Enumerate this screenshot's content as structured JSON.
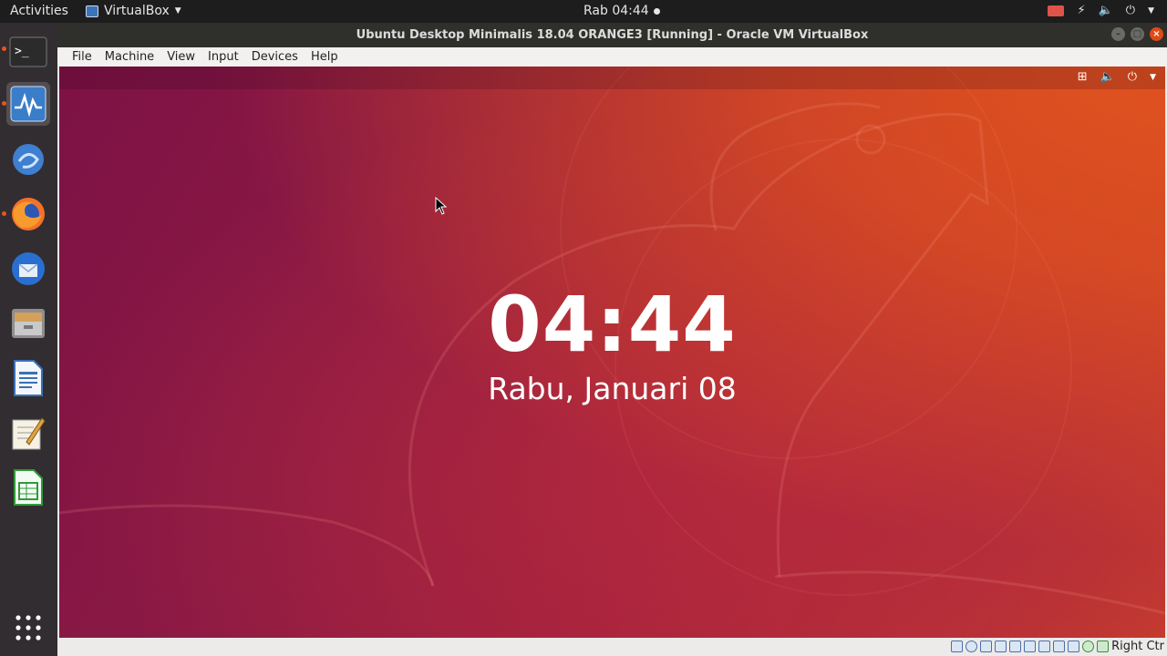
{
  "top_panel": {
    "activities": "Activities",
    "app_menu": "VirtualBox",
    "clock": "Rab 04:44"
  },
  "dock": {
    "items": [
      "terminal",
      "system-monitor",
      "vbox",
      "firefox",
      "thunderbird",
      "files",
      "writer",
      "text-editor",
      "calc"
    ]
  },
  "window": {
    "title": "Ubuntu Desktop Minimalis 18.04 ORANGE3 [Running] - Oracle VM VirtualBox",
    "menu": [
      "File",
      "Machine",
      "View",
      "Input",
      "Devices",
      "Help"
    ]
  },
  "guest": {
    "time": "04:44",
    "date": "Rabu, Januari 08"
  },
  "statusbar": {
    "host_key": "Right Ctr"
  },
  "colors": {
    "accent": "#e95420",
    "panel": "#1d1d1d",
    "wallpaper_start": "#7d1245",
    "wallpaper_end": "#e0521e"
  }
}
